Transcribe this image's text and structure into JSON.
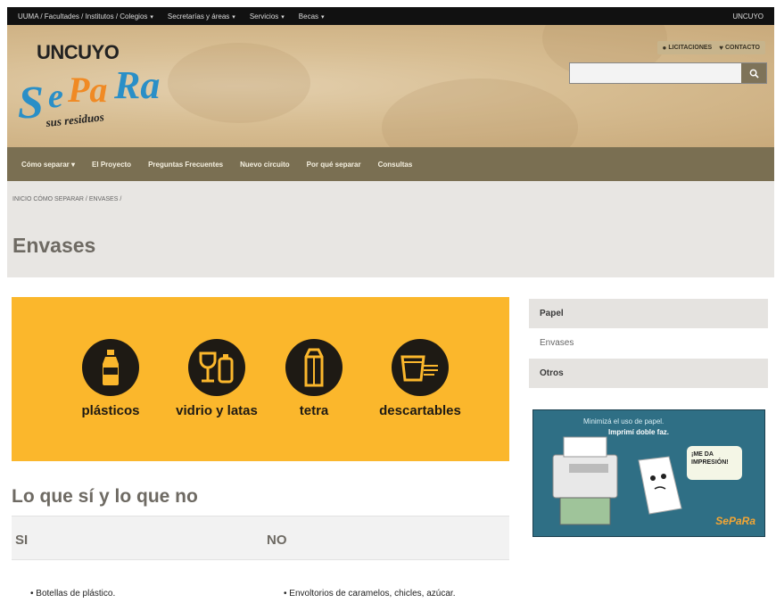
{
  "topbar": {
    "items": [
      {
        "label": "UUMA / Facultades / Institutos / Colegios",
        "caret": "▾"
      },
      {
        "label": "Secretarías y áreas",
        "caret": "▾"
      },
      {
        "label": "Servicios",
        "caret": "▾"
      },
      {
        "label": "Becas",
        "caret": "▾"
      }
    ],
    "right_label": "UNCUYO"
  },
  "header": {
    "brand": "UNCUYO",
    "logo_text": "SePaRa",
    "logo_subtext": "sus residuos",
    "buttons": [
      {
        "icon": "info-icon",
        "label": "LICITACIONES"
      },
      {
        "icon": "map-pin-icon",
        "label": "CONTACTO"
      }
    ],
    "search": {
      "value": "",
      "placeholder": "",
      "button_icon": "search-icon"
    }
  },
  "mainnav": {
    "items": [
      {
        "label": "Cómo separar ▾"
      },
      {
        "label": "El Proyecto"
      },
      {
        "label": "Preguntas Frecuentes"
      },
      {
        "label": "Nuevo circuito"
      },
      {
        "label": "Por qué separar"
      },
      {
        "label": "Consultas"
      }
    ]
  },
  "page": {
    "breadcrumb": "INICIO CÓMO SEPARAR / ENVASES /",
    "title": "Envases"
  },
  "banner": {
    "categories": [
      {
        "label": "plásticos",
        "icon": "bottle-icon"
      },
      {
        "label": "vidrio y latas",
        "icon": "glass-can-icon"
      },
      {
        "label": "tetra",
        "icon": "tetra-pack-icon"
      },
      {
        "label": "descartables",
        "icon": "disposable-cup-icon"
      }
    ],
    "colors": {
      "background": "#fbb72c",
      "circle": "#1e1a14"
    }
  },
  "content": {
    "section_title": "Lo que sí y lo que no",
    "table": {
      "headers": [
        "SI",
        "NO"
      ],
      "rows": [
        [
          "Botellas de plástico.",
          "Envoltorios de caramelos, chicles, azúcar."
        ]
      ]
    }
  },
  "sidebar": {
    "items": [
      {
        "label": "Papel",
        "style": "active"
      },
      {
        "label": "Envases",
        "style": "plain"
      },
      {
        "label": "Otros",
        "style": "active"
      }
    ]
  },
  "ad": {
    "line1": "Minimizá el uso de papel.",
    "line2": "Imprimí doble faz.",
    "bubble": "¡ME DA IMPRESIÓN!",
    "signature": "SePaRa"
  }
}
